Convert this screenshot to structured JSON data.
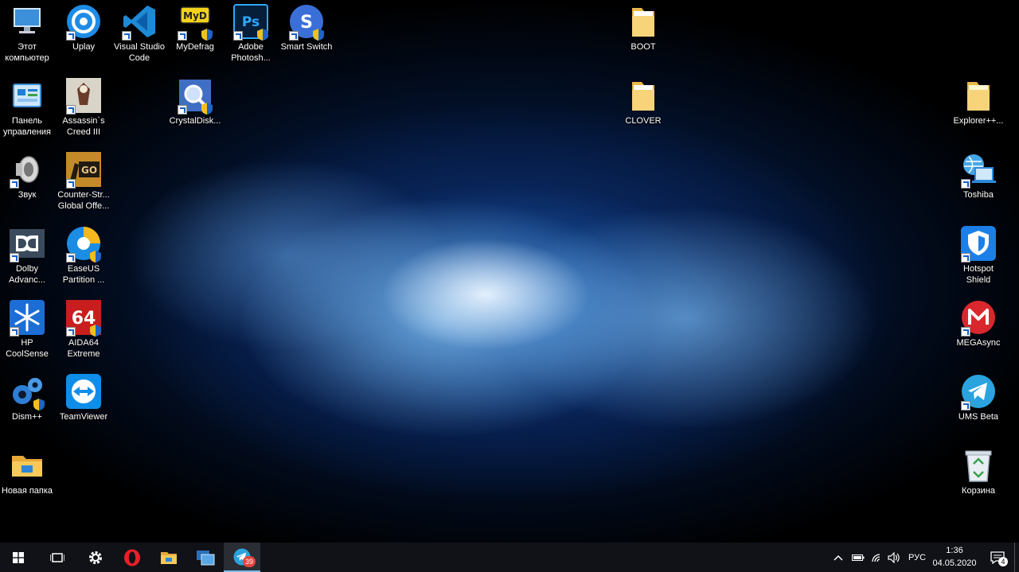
{
  "desktop": {
    "icons": [
      {
        "label": "Этот\nкомпьютер",
        "icon": "this-pc-icon"
      },
      {
        "label": "Uplay",
        "icon": "uplay-icon"
      },
      {
        "label": "Visual Studio\nCode",
        "icon": "vscode-icon"
      },
      {
        "label": "MyDefrag",
        "icon": "mydefrag-icon"
      },
      {
        "label": "Adobe\nPhotosh...",
        "icon": "photoshop-icon"
      },
      {
        "label": "Smart Switch",
        "icon": "smart-switch-icon"
      },
      {
        "label": "BOOT",
        "icon": "folder-icon"
      },
      {
        "label": "Панель\nуправления",
        "icon": "control-panel-icon"
      },
      {
        "label": "Assassin`s\nCreed III",
        "icon": "assassins-creed-icon"
      },
      {
        "label": "CrystalDisk...",
        "icon": "crystaldisk-icon"
      },
      {
        "label": "CLOVER",
        "icon": "folder-icon"
      },
      {
        "label": "Explorer++...",
        "icon": "folder-icon"
      },
      {
        "label": "Звук",
        "icon": "speaker-icon"
      },
      {
        "label": "Counter-Str...\nGlobal Offe...",
        "icon": "csgo-icon"
      },
      {
        "label": "Toshiba",
        "icon": "toshiba-icon"
      },
      {
        "label": "Dolby\nAdvanc...",
        "icon": "dolby-icon"
      },
      {
        "label": "EaseUS\nPartition ...",
        "icon": "easeus-icon"
      },
      {
        "label": "Hotspot\nShield",
        "icon": "hotspot-shield-icon"
      },
      {
        "label": "HP\nCoolSense",
        "icon": "coolsense-icon"
      },
      {
        "label": "AIDA64\nExtreme",
        "icon": "aida64-icon"
      },
      {
        "label": "MEGAsync",
        "icon": "megasync-icon"
      },
      {
        "label": "Dism++",
        "icon": "dism-icon"
      },
      {
        "label": "TeamViewer",
        "icon": "teamviewer-icon"
      },
      {
        "label": "UMS Beta",
        "icon": "telegram-icon"
      },
      {
        "label": "Новая папка",
        "icon": "folder-icon"
      },
      {
        "label": "Корзина",
        "icon": "recycle-bin-icon"
      }
    ]
  },
  "taskbar": {
    "start_icon": "windows-logo-icon",
    "task_view_icon": "task-view-icon",
    "pinned": [
      {
        "icon": "settings-gear-icon"
      },
      {
        "icon": "opera-icon"
      },
      {
        "icon": "file-explorer-icon"
      },
      {
        "icon": "windows-store-icon"
      },
      {
        "icon": "telegram-icon",
        "badge": "39"
      }
    ],
    "tray": {
      "language": "РУС",
      "time": "1:36",
      "date": "04.05.2020",
      "notification_count": "4"
    }
  },
  "colors": {
    "taskbar": "#101217",
    "accent": "#1a5fc9"
  }
}
